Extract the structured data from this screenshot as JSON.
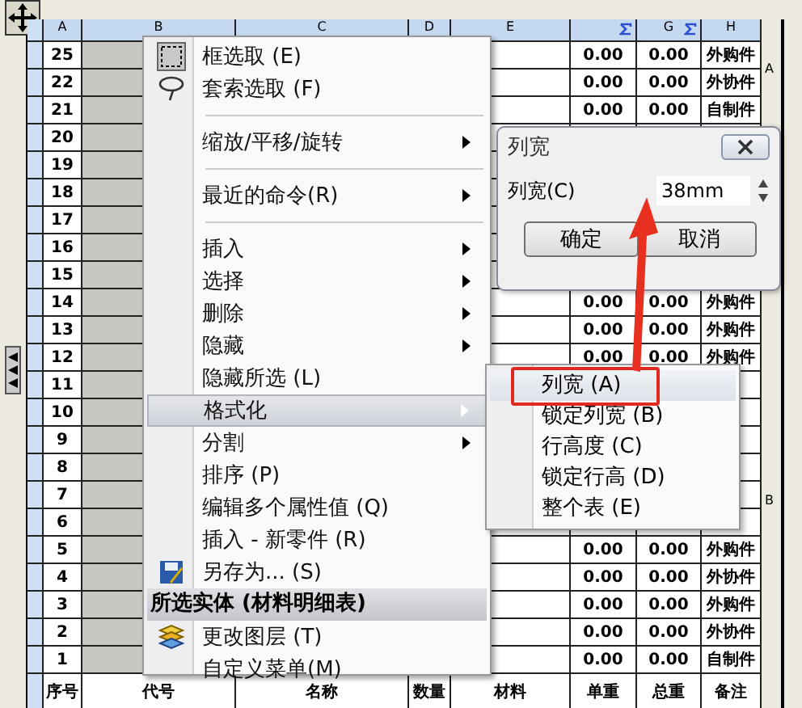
{
  "table": {
    "columns": [
      {
        "label": "A",
        "sum": false
      },
      {
        "label": "B",
        "sum": false
      },
      {
        "label": "C",
        "sum": false
      },
      {
        "label": "D",
        "sum": false
      },
      {
        "label": "E",
        "sum": false
      },
      {
        "sum": true
      },
      {
        "label": "G",
        "sum": true
      },
      {
        "label": "H",
        "sum": false
      }
    ],
    "rows": [
      {
        "a": "25",
        "f": "0.00",
        "g": "0.00",
        "h": "外购件"
      },
      {
        "a": "22",
        "f": "0.00",
        "g": "0.00",
        "h": "外协件"
      },
      {
        "a": "21",
        "f": "0.00",
        "g": "0.00",
        "h": "自制件"
      },
      {
        "a": "20"
      },
      {
        "a": "19"
      },
      {
        "a": "18"
      },
      {
        "a": "17"
      },
      {
        "a": "16"
      },
      {
        "a": "15"
      },
      {
        "a": "14",
        "f": "0.00",
        "g": "0.00",
        "h": "外购件"
      },
      {
        "a": "13",
        "f": "0.00",
        "g": "0.00",
        "h": "外购件"
      },
      {
        "a": "12",
        "f": "0.00",
        "g": "0.00",
        "h": "外购件"
      },
      {
        "a": "11"
      },
      {
        "a": "10"
      },
      {
        "a": "9"
      },
      {
        "a": "8"
      },
      {
        "a": "7"
      },
      {
        "a": "6"
      },
      {
        "a": "5",
        "f": "0.00",
        "g": "0.00",
        "h": "外购件"
      },
      {
        "a": "4",
        "f": "0.00",
        "g": "0.00",
        "h": "外协件"
      },
      {
        "a": "3",
        "f": "0.00",
        "g": "0.00",
        "h": "外购件"
      },
      {
        "a": "2",
        "f": "0.00",
        "g": "0.00",
        "h": "外协件"
      },
      {
        "a": "1",
        "f": "0.00",
        "g": "0.00",
        "h": "自制件"
      }
    ],
    "footer": [
      "序号",
      "代号",
      "名称",
      "数量",
      "材料",
      "单重",
      "总重",
      "备注"
    ]
  },
  "zone_labels": [
    "A",
    "B"
  ],
  "context_menu": {
    "items": [
      {
        "kind": "item",
        "label": "框选取 (E)",
        "submenu": false,
        "selected": false
      },
      {
        "kind": "item",
        "label": "套索选取 (F)",
        "submenu": false,
        "selected": false
      },
      {
        "kind": "separator"
      },
      {
        "kind": "item",
        "label": "缩放/平移/旋转",
        "submenu": true,
        "selected": false
      },
      {
        "kind": "separator"
      },
      {
        "kind": "item",
        "label": "最近的命令(R)",
        "submenu": true,
        "selected": false
      },
      {
        "kind": "separator"
      },
      {
        "kind": "item",
        "label": "插入",
        "submenu": true,
        "selected": false
      },
      {
        "kind": "item",
        "label": "选择",
        "submenu": true,
        "selected": false
      },
      {
        "kind": "item",
        "label": "删除",
        "submenu": true,
        "selected": false
      },
      {
        "kind": "item",
        "label": "隐藏",
        "submenu": true,
        "selected": false
      },
      {
        "kind": "item",
        "label": "隐藏所选 (L)",
        "submenu": false,
        "selected": false
      },
      {
        "kind": "item",
        "label": "格式化",
        "submenu": true,
        "selected": true
      },
      {
        "kind": "item",
        "label": "分割",
        "submenu": true,
        "selected": false
      },
      {
        "kind": "item",
        "label": "排序 (P)",
        "submenu": false,
        "selected": false
      },
      {
        "kind": "item",
        "label": "编辑多个属性值 (Q)",
        "submenu": false,
        "selected": false
      },
      {
        "kind": "item",
        "label": "插入 - 新零件 (R)",
        "submenu": false,
        "selected": false
      },
      {
        "kind": "item",
        "label": "另存为... (S)",
        "submenu": false,
        "selected": false
      },
      {
        "kind": "header",
        "label": "所选实体 (材料明细表)"
      },
      {
        "kind": "item",
        "label": "更改图层 (T)",
        "submenu": false,
        "selected": false
      },
      {
        "kind": "item",
        "label": "自定义菜单(M)",
        "submenu": false,
        "selected": false
      }
    ]
  },
  "submenu": {
    "items": [
      {
        "label": "列宽 (A)",
        "selected": true,
        "highlighted": true
      },
      {
        "label": "锁定列宽 (B)",
        "selected": false,
        "highlighted": false
      },
      {
        "label": "行高度 (C)",
        "selected": false,
        "highlighted": false
      },
      {
        "label": "锁定行高 (D)",
        "selected": false,
        "highlighted": false
      },
      {
        "label": "整个表 (E)",
        "selected": false,
        "highlighted": false
      }
    ]
  },
  "dialog": {
    "title": "列宽",
    "field_label": "列宽(C)",
    "value": "38mm",
    "buttons": [
      "确定",
      "取消"
    ]
  }
}
